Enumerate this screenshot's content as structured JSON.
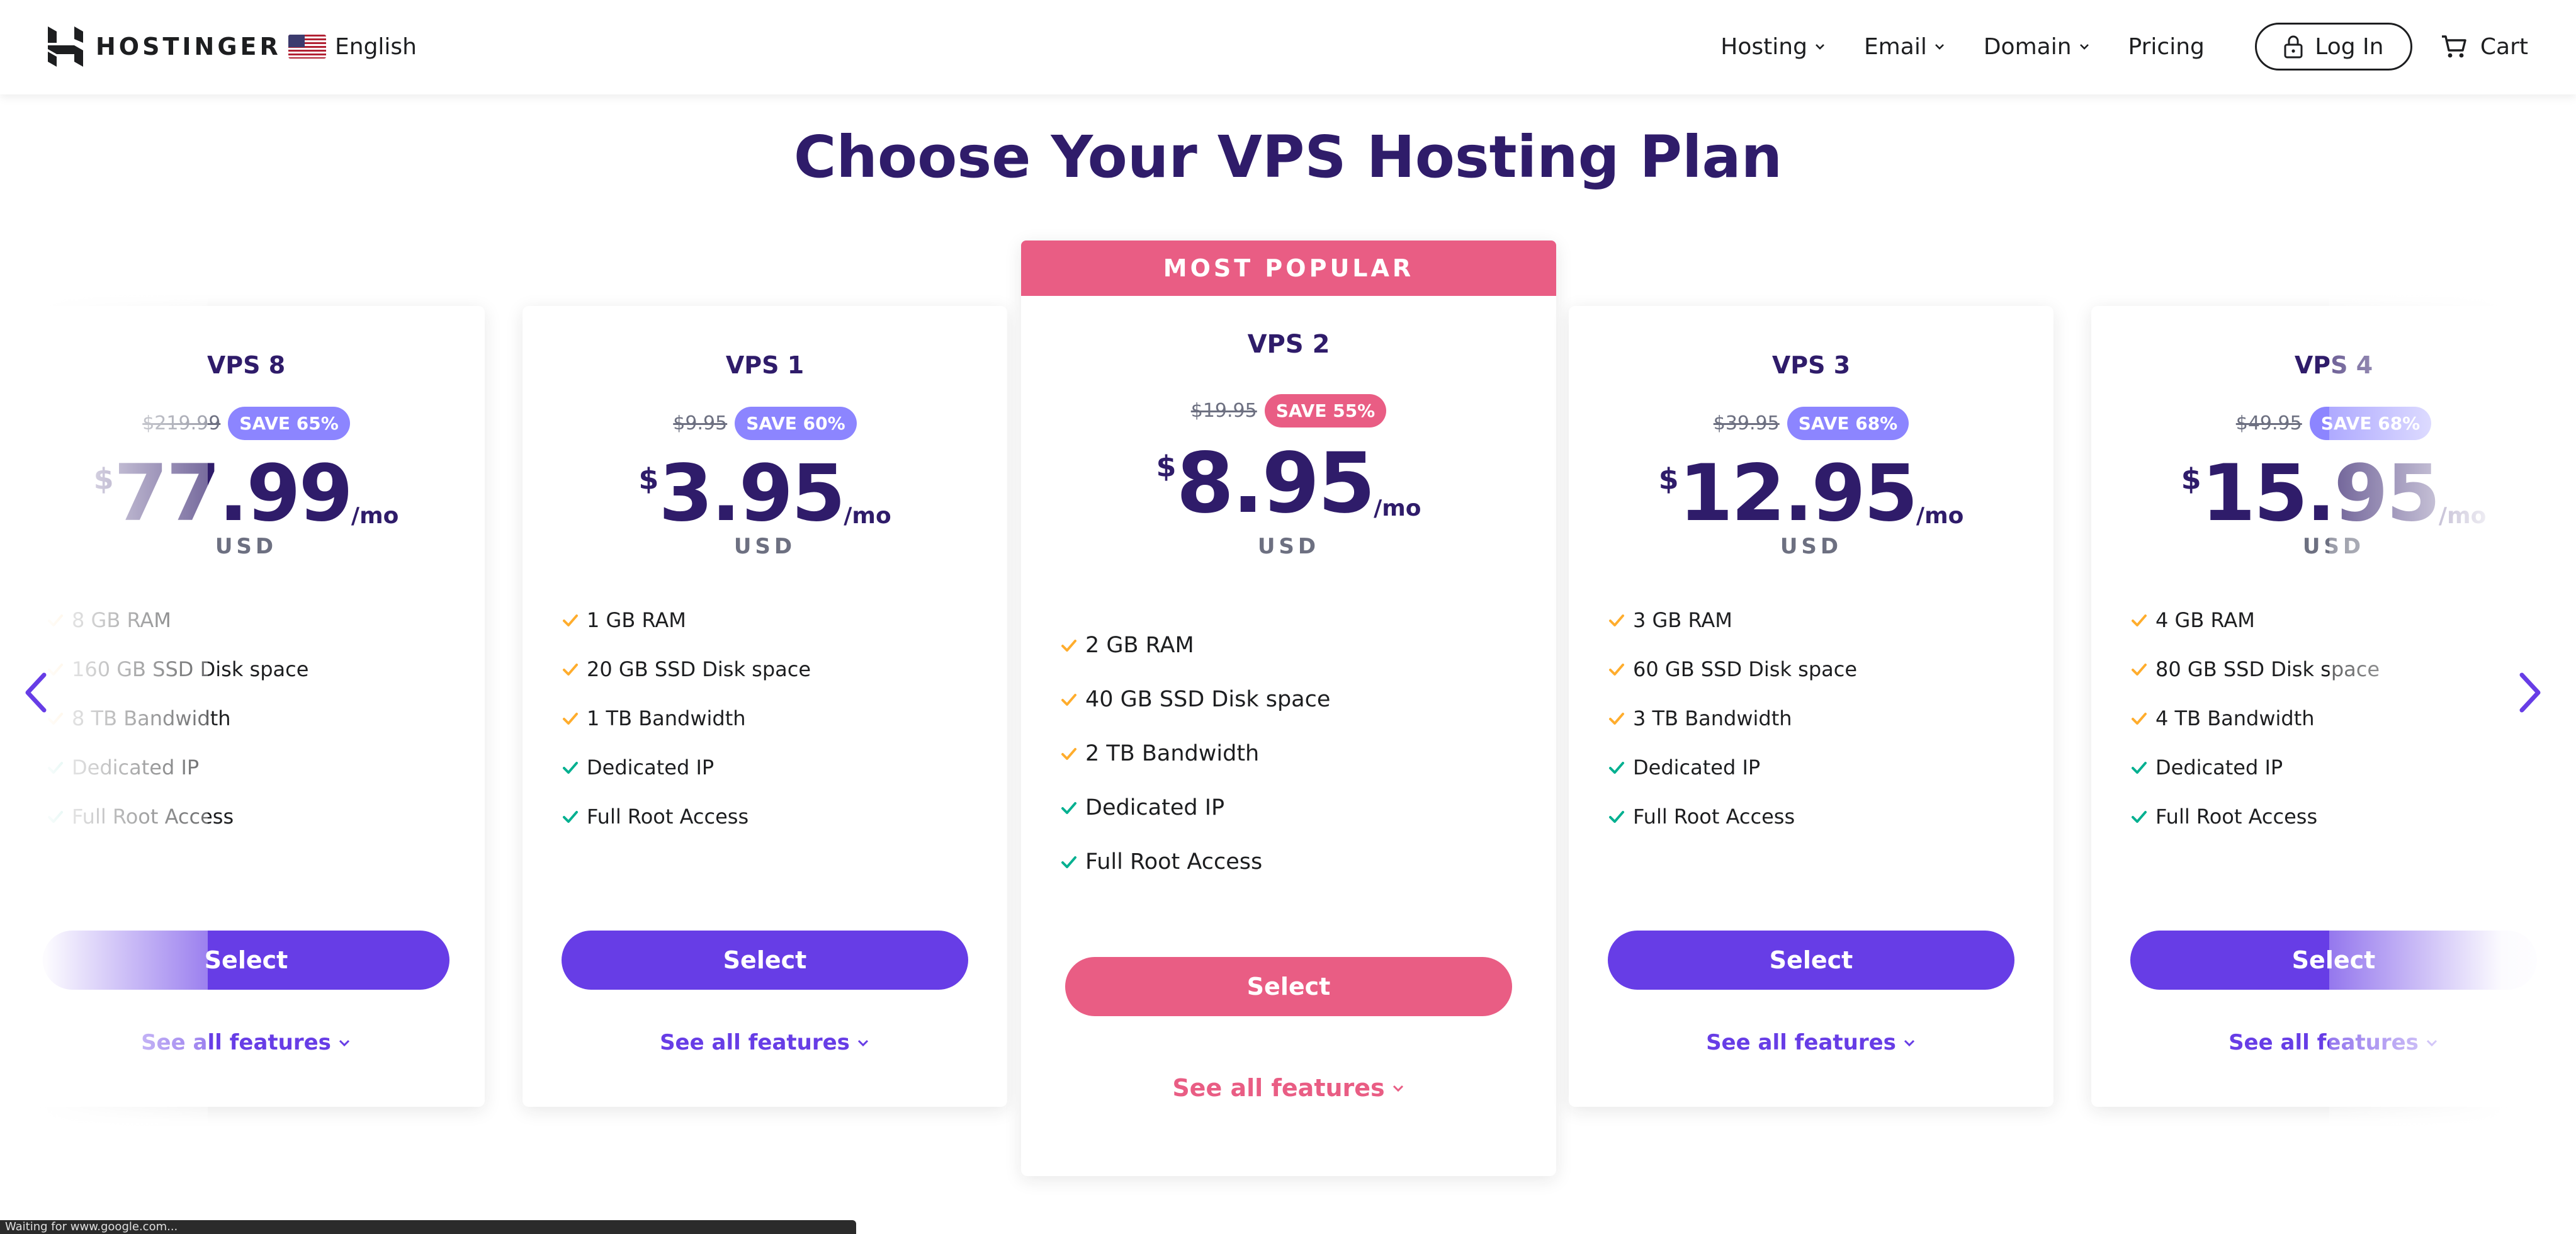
{
  "header": {
    "brand": "HOSTINGER",
    "language": "English",
    "nav": [
      {
        "label": "Hosting",
        "has_dropdown": true
      },
      {
        "label": "Email",
        "has_dropdown": true
      },
      {
        "label": "Domain",
        "has_dropdown": true
      },
      {
        "label": "Pricing",
        "has_dropdown": false
      }
    ],
    "login_label": "Log In",
    "cart_label": "Cart"
  },
  "main": {
    "title": "Choose Your VPS Hosting Plan",
    "popular_banner": "MOST POPULAR",
    "select_label": "Select",
    "see_all_label": "See all features",
    "currency_symbol": "$",
    "per_month": "/mo",
    "currency_code": "USD",
    "plans": [
      {
        "name": "VPS 8",
        "old_price": "$219.99",
        "save": "SAVE 65%",
        "price": "77.99",
        "features": [
          "8 GB RAM",
          "160 GB SSD Disk space",
          "8 TB Bandwidth",
          "Dedicated IP",
          "Full Root Access"
        ],
        "partially_hidden": true
      },
      {
        "name": "VPS 1",
        "old_price": "$9.95",
        "save": "SAVE 60%",
        "price": "3.95",
        "features": [
          "1 GB RAM",
          "20 GB SSD Disk space",
          "1 TB Bandwidth",
          "Dedicated IP",
          "Full Root Access"
        ]
      },
      {
        "name": "VPS 2",
        "old_price": "$19.95",
        "save": "SAVE 55%",
        "price": "8.95",
        "features": [
          "2 GB RAM",
          "40 GB SSD Disk space",
          "2 TB Bandwidth",
          "Dedicated IP",
          "Full Root Access"
        ],
        "popular": true
      },
      {
        "name": "VPS 3",
        "old_price": "$39.95",
        "save": "SAVE 68%",
        "price": "12.95",
        "features": [
          "3 GB RAM",
          "60 GB SSD Disk space",
          "3 TB Bandwidth",
          "Dedicated IP",
          "Full Root Access"
        ]
      },
      {
        "name": "VPS 4",
        "old_price": "$49.95",
        "save": "SAVE 68%",
        "price": "15.95",
        "features": [
          "4 GB RAM",
          "80 GB SSD Disk space",
          "4 TB Bandwidth",
          "Dedicated IP",
          "Full Root Access"
        ],
        "partially_hidden": true
      }
    ]
  },
  "status_bar": "Waiting for www.google.com...",
  "colors": {
    "brand_purple": "#673de6",
    "popular_pink": "#e95d84",
    "heading_navy": "#2f1c6a",
    "badge_purple": "#8c85ff",
    "check_orange": "#ffad2d",
    "check_green": "#00b090"
  },
  "icons": [
    "hostinger-logo",
    "us-flag-icon",
    "chevron-down-icon",
    "lock-icon",
    "cart-icon",
    "check-icon",
    "arrow-left-icon",
    "arrow-right-icon"
  ]
}
